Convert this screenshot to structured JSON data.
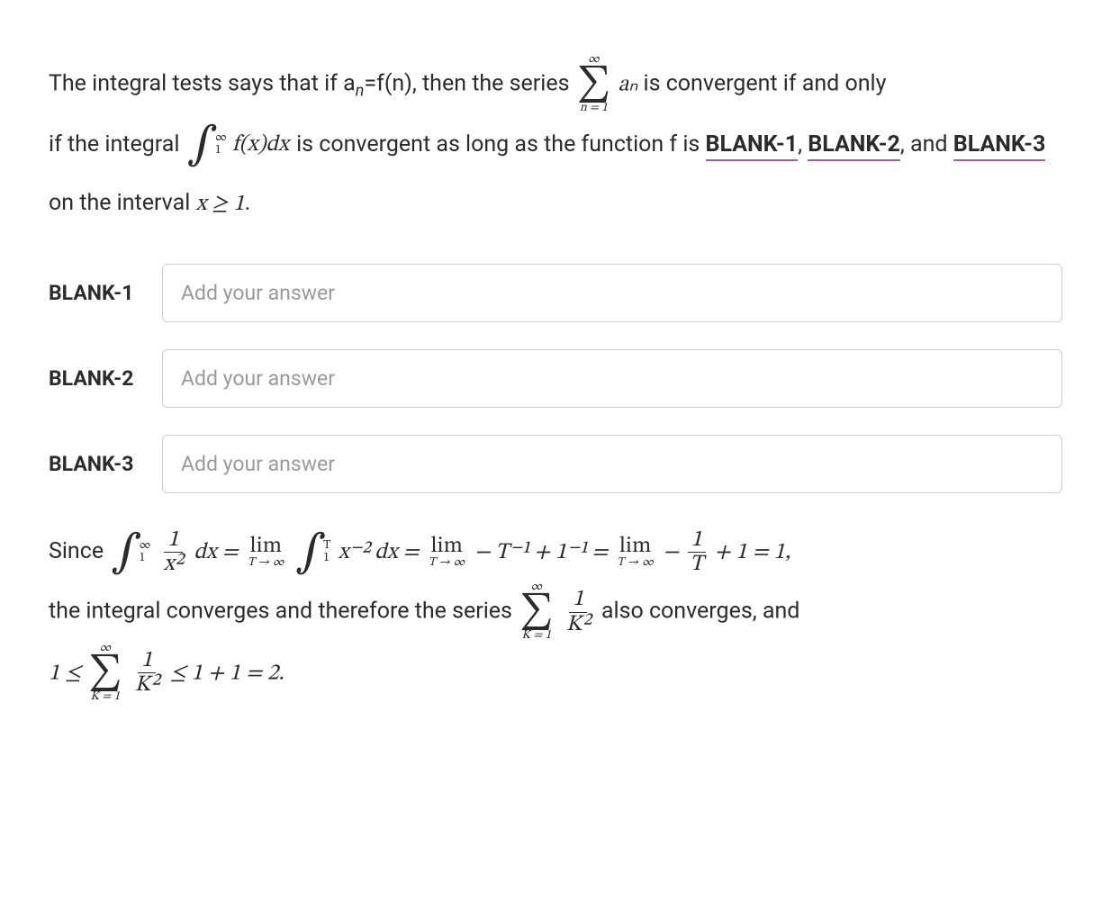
{
  "question": {
    "part1_a": "The integral tests says that if a",
    "part1_sub": "n",
    "part1_b": "=f(n), then the series ",
    "sum1": {
      "top": "∞",
      "sym": "∑",
      "bot": "n = 1",
      "term": "aₙ"
    },
    "part1_c": " is convergent if and only",
    "part2_a": "if the integral ",
    "int1": {
      "sym": "∫",
      "low": "1",
      "high": "∞",
      "body": "f(x)dx"
    },
    "part2_b": " is convergent as long as the function f is ",
    "blank1_ref": "BLANK-1",
    "comma1": ", ",
    "blank2_ref": "BLANK-2",
    "comma2": ", and ",
    "blank3_ref": "BLANK-3",
    "part2_c": " on the interval ",
    "interval": "x ≥ 1",
    "period": "."
  },
  "answers": {
    "blank1": {
      "label": "BLANK-1",
      "placeholder": "Add your answer",
      "value": ""
    },
    "blank2": {
      "label": "BLANK-2",
      "placeholder": "Add your answer",
      "value": ""
    },
    "blank3": {
      "label": "BLANK-3",
      "placeholder": "Add your answer",
      "value": ""
    }
  },
  "solution": {
    "lead": "Since ",
    "int2": {
      "sym": "∫",
      "low": "1",
      "high": "∞"
    },
    "frac1": {
      "num": "1",
      "den": "x²"
    },
    "dx1": "dx =",
    "lim1": {
      "top": "lim",
      "bot": "T → ∞"
    },
    "int3": {
      "sym": "∫",
      "low": "1",
      "high": "T"
    },
    "body3": "x⁻² dx =",
    "lim2": {
      "top": "lim",
      "bot": "T → ∞"
    },
    "mid": " − T⁻¹ + 1⁻¹ = ",
    "lim3": {
      "top": "lim",
      "bot": "T → ∞"
    },
    "minus": " − ",
    "frac2": {
      "num": "1",
      "den": "T"
    },
    "tail": " + 1 = 1,",
    "line2a": "the integral converges and therefore the series ",
    "sum2": {
      "top": "∞",
      "sym": "∑",
      "bot": "K = 1"
    },
    "frac3": {
      "num": "1",
      "den": "K²"
    },
    "line2b": " also converges, and",
    "line3_lead": "1 ≤ ",
    "sum3": {
      "top": "∞",
      "sym": "∑",
      "bot": "K = 1"
    },
    "frac4": {
      "num": "1",
      "den": "K²"
    },
    "line3_tail": " ≤ 1 + 1 = 2."
  }
}
